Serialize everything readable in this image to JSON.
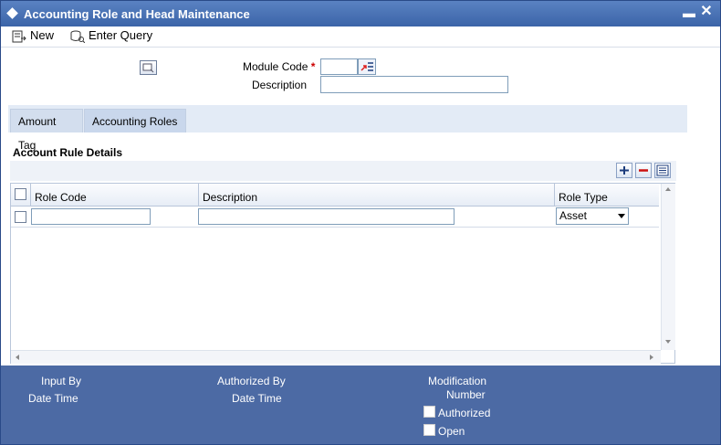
{
  "window": {
    "title": "Accounting Role and Head Maintenance",
    "min_glyph": "▬",
    "close_glyph": "✕"
  },
  "toolbar": {
    "new_label": "New",
    "enter_query_label": "Enter Query"
  },
  "form": {
    "module_code_label": "Module Code",
    "required_mark": "*",
    "module_code_value": "",
    "description_label": "Description",
    "description_value": ""
  },
  "tabs": [
    {
      "label": "Amount Tag",
      "selected": false
    },
    {
      "label": "Accounting Roles",
      "selected": true
    }
  ],
  "account_rule": {
    "section_title": "Account Rule Details",
    "columns": [
      "Role Code",
      "Description",
      "Role Type"
    ],
    "rows": [
      {
        "role_code": "",
        "description": "",
        "role_type": "Asset"
      }
    ]
  },
  "footer": {
    "input_by": "Input By",
    "date_time_1": "Date Time",
    "authorized_by": "Authorized By",
    "date_time_2": "Date Time",
    "modification": "Modification",
    "number": "Number",
    "authorized": "Authorized",
    "open": "Open"
  },
  "colors": {
    "title_bar": "#3b64a8",
    "footer": "#4c6aa4",
    "tab_strip": "#e3ebf6"
  }
}
